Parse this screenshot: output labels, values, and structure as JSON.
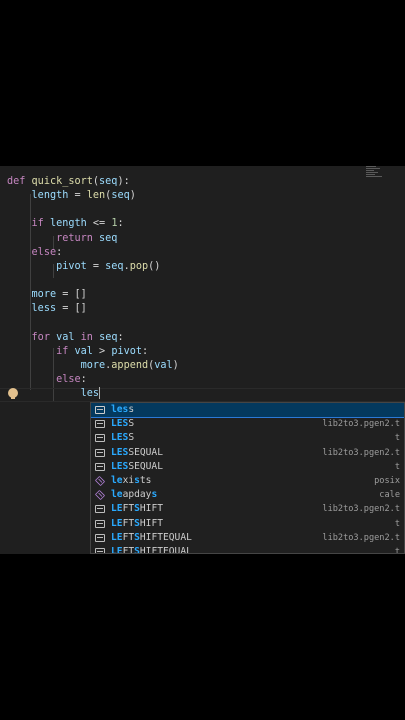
{
  "code_lines": [
    "def quick_sort(seq):",
    "    length = len(seq)",
    "",
    "    if length <= 1:",
    "        return seq",
    "    else:",
    "        pivot = seq.pop()",
    "",
    "    more = []",
    "    less = []",
    "",
    "    for val in seq:",
    "        if val > pivot:",
    "            more.append(val)",
    "        else:",
    "            les"
  ],
  "typed_prefix": "les",
  "suggestions": [
    {
      "match": "les",
      "rest": "s",
      "detail": "",
      "icon": "keyword-icon"
    },
    {
      "match": "LES",
      "rest": "S",
      "detail": "lib2to3.pgen2.t",
      "icon": "variable-icon"
    },
    {
      "match": "LES",
      "rest": "S",
      "detail": "t",
      "icon": "variable-icon"
    },
    {
      "match": "LES",
      "rest": "SEQUAL",
      "detail": "lib2to3.pgen2.t",
      "icon": "variable-icon"
    },
    {
      "match": "LES",
      "rest": "SEQUAL",
      "detail": "t",
      "icon": "variable-icon"
    },
    {
      "match": "le",
      "mid": "xi",
      "match2": "s",
      "rest": "ts",
      "detail": "posix",
      "icon": "cube-icon"
    },
    {
      "match": "le",
      "mid": "apday",
      "match2": "s",
      "rest": "",
      "detail": "cale",
      "icon": "cube-icon"
    },
    {
      "match": "LE",
      "mid": "FT",
      "match2": "S",
      "rest": "HIFT",
      "detail": "lib2to3.pgen2.t",
      "icon": "variable-icon"
    },
    {
      "match": "LE",
      "mid": "FT",
      "match2": "S",
      "rest": "HIFT",
      "detail": "t",
      "icon": "variable-icon"
    },
    {
      "match": "LE",
      "mid": "FT",
      "match2": "S",
      "rest": "HIFTEQUAL",
      "detail": "lib2to3.pgen2.t",
      "icon": "variable-icon"
    },
    {
      "match": "LE",
      "mid": "FT",
      "match2": "S",
      "rest": "HIFTEQUAL",
      "detail": "t",
      "icon": "variable-icon"
    }
  ],
  "colors": {
    "selection": "#04395e",
    "match_highlight": "#2aaaff",
    "background": "#1f1f1f"
  }
}
